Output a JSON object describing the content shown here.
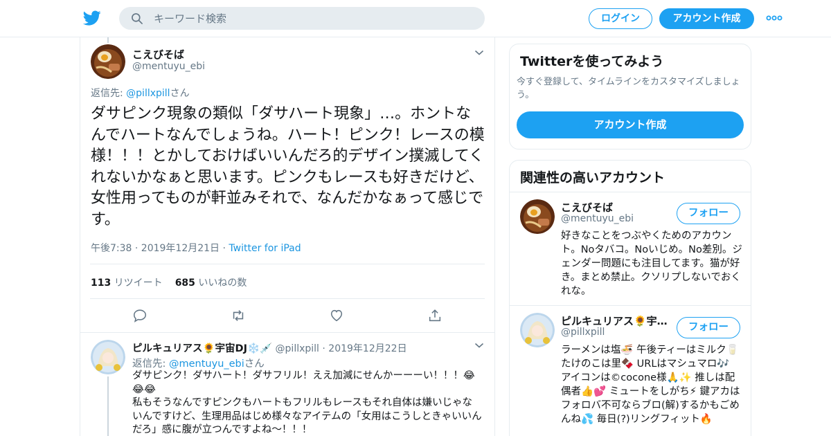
{
  "header": {
    "logo_icon": "twitter-bird-icon",
    "search_placeholder": "キーワード検索",
    "login_label": "ログイン",
    "signup_label": "アカウント作成",
    "more_icon": "more-dots-icon",
    "accent_color": "#1da1f2"
  },
  "tweet": {
    "author_name": "こえびそば",
    "author_handle": "@mentuyu_ebi",
    "reply_prefix": "返信先: ",
    "reply_handle": "@pillxpill",
    "reply_suffix": "さん",
    "text": "ダサピンク現象の類似「ダサハート現象」…。ホントなんでハートなんでしょうね。ハート！ピンク！レースの模様！！！とかしておけばいいんだろ的デザイン撲滅してくれないかなぁと思います。ピンクもレースも好きだけど、女性用ってものが軒並みそれで、なんだかなぁって感じです。",
    "time": "午後7:38 · 2019年12月21日 · ",
    "source": "Twitter for iPad",
    "retweet_count": "113",
    "retweet_label": "リツイート",
    "like_count": "685",
    "like_label": "いいねの数"
  },
  "reply": {
    "author_name": "ピルキュリアス🌻宇宙DJ❄️💉",
    "author_handle": "@pillxpill",
    "date": "· 2019年12月22日",
    "reply_prefix": "返信先: ",
    "reply_handle": "@mentuyu_ebi",
    "reply_suffix": "さん",
    "text_line1": "ダサピンク！ダサハート！ダサフリル！ええ加減にせんかーーーい！！！😂😂😂",
    "text_line2": "私もそうなんですピンクもハートもフリルもレースもそれ自体は嫌いじゃないんですけど、生理用品はじめ様々なアイテムの「女用はこうしときゃいいんだろ」感に腹が立つんですよね〜！！！"
  },
  "sidebar": {
    "signup_card": {
      "title": "Twitterを使ってみよう",
      "text": "今すぐ登録して、タイムラインをカスタマイズしましょう。",
      "button": "アカウント作成"
    },
    "related": {
      "title": "関連性の高いアカウント",
      "accounts": [
        {
          "name": "こえびそば",
          "handle": "@mentuyu_ebi",
          "follow_label": "フォロー",
          "bio": "好きなことをつぶやくためのアカウント。Noタバコ。Noいじめ。No差別。ジェンダー問題にも注目してます。猫が好き。まとめ禁止。クソリプしないでおくれな。"
        },
        {
          "name": "ピルキュリアス🌻宇…",
          "handle": "@pillxpill",
          "follow_label": "フォロー",
          "bio": "ラーメンは塩🍜 午後ティーはミルク🥛 たけのこは里🍫 URLはマシュマロ🎶 アイコンは©cocone様🙏✨ 推しは配偶者👍💕 ミュートをしがち⚡ 鍵アカはフォロバ不可ならブロ(解)するかもごめんね💦 毎日(?)リングフィット🔥"
        }
      ]
    }
  }
}
